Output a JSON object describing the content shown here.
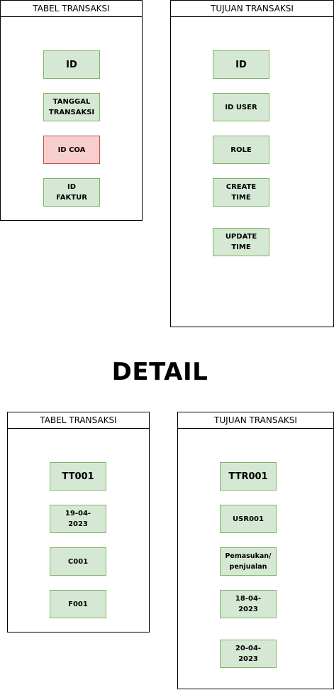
{
  "top": {
    "tabel_transaksi": {
      "title": "TABEL TRANSAKSI",
      "fields": [
        "ID",
        "TANGGAL\nTRANSAKSI",
        "ID COA",
        "ID\nFAKTUR"
      ]
    },
    "tujuan_transaksi": {
      "title": "TUJUAN TRANSAKSI",
      "fields": [
        "ID",
        "ID USER",
        "ROLE",
        "CREATE\nTIME",
        "UPDATE\nTIME"
      ]
    }
  },
  "heading": "DETAIL",
  "detail": {
    "tabel_transaksi": {
      "title": "TABEL TRANSAKSI",
      "fields": [
        "TT001",
        "19-04-\n2023",
        "C001",
        "F001"
      ]
    },
    "tujuan_transaksi": {
      "title": "TUJUAN TRANSAKSI",
      "fields": [
        "TTR001",
        "USR001",
        "Pemasukan/\npenjualan",
        "18-04-\n2023",
        "20-04-\n2023"
      ]
    }
  },
  "colors": {
    "field_fill": "#d5e8d4",
    "field_border": "#82b366",
    "highlight_fill": "#f8cecc",
    "highlight_border": "#b85450"
  }
}
